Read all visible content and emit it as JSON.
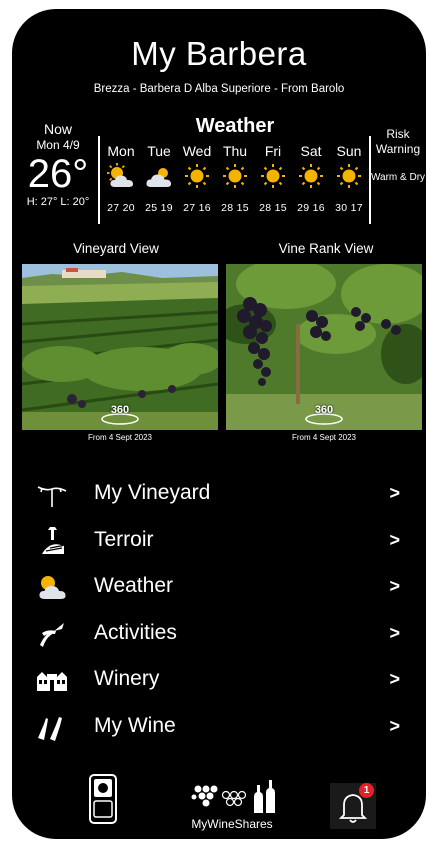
{
  "app": {
    "title": "My Barbera",
    "subtitle": "Brezza - Barbera D Alba Superiore - From Barolo"
  },
  "now": {
    "label": "Now",
    "date": "Mon 4/9",
    "temp": "26°",
    "high_low": "H: 27° L: 20°"
  },
  "weather": {
    "heading": "Weather",
    "days": [
      {
        "name": "Mon",
        "icon": "sun-cloud-icon",
        "temps": "27 20"
      },
      {
        "name": "Tue",
        "icon": "cloud-icon",
        "temps": "25 19"
      },
      {
        "name": "Wed",
        "icon": "sun-icon",
        "temps": "27 16"
      },
      {
        "name": "Thu",
        "icon": "sun-icon",
        "temps": "28 15"
      },
      {
        "name": "Fri",
        "icon": "sun-icon",
        "temps": "28 15"
      },
      {
        "name": "Sat",
        "icon": "sun-icon",
        "temps": "29 16"
      },
      {
        "name": "Sun",
        "icon": "sun-icon",
        "temps": "30 17"
      }
    ]
  },
  "risk": {
    "title": "Risk Warning",
    "value": "Warm & Dry"
  },
  "views": {
    "vineyard": {
      "title": "Vineyard View",
      "badge": "360",
      "caption": "From 4 Sept 2023"
    },
    "vine_rank": {
      "title": "Vine Rank View",
      "badge": "360",
      "caption": "From 4 Sept 2023"
    }
  },
  "menu": {
    "chevron": ">",
    "items": [
      {
        "label": "My Vineyard",
        "icon": "vine-icon"
      },
      {
        "label": "Terroir",
        "icon": "terroir-icon"
      },
      {
        "label": "Weather",
        "icon": "sun-cloud-icon"
      },
      {
        "label": "Activities",
        "icon": "pruning-shears-icon"
      },
      {
        "label": "Winery",
        "icon": "winery-icon"
      },
      {
        "label": "My Wine",
        "icon": "wine-bottles-icon"
      }
    ]
  },
  "bottom": {
    "shares_label": "MyWineShares",
    "notification_count": "1"
  },
  "colors": {
    "background": "#000000",
    "text": "#ffffff",
    "sun": "#f5b301",
    "badge": "#e8202a"
  }
}
